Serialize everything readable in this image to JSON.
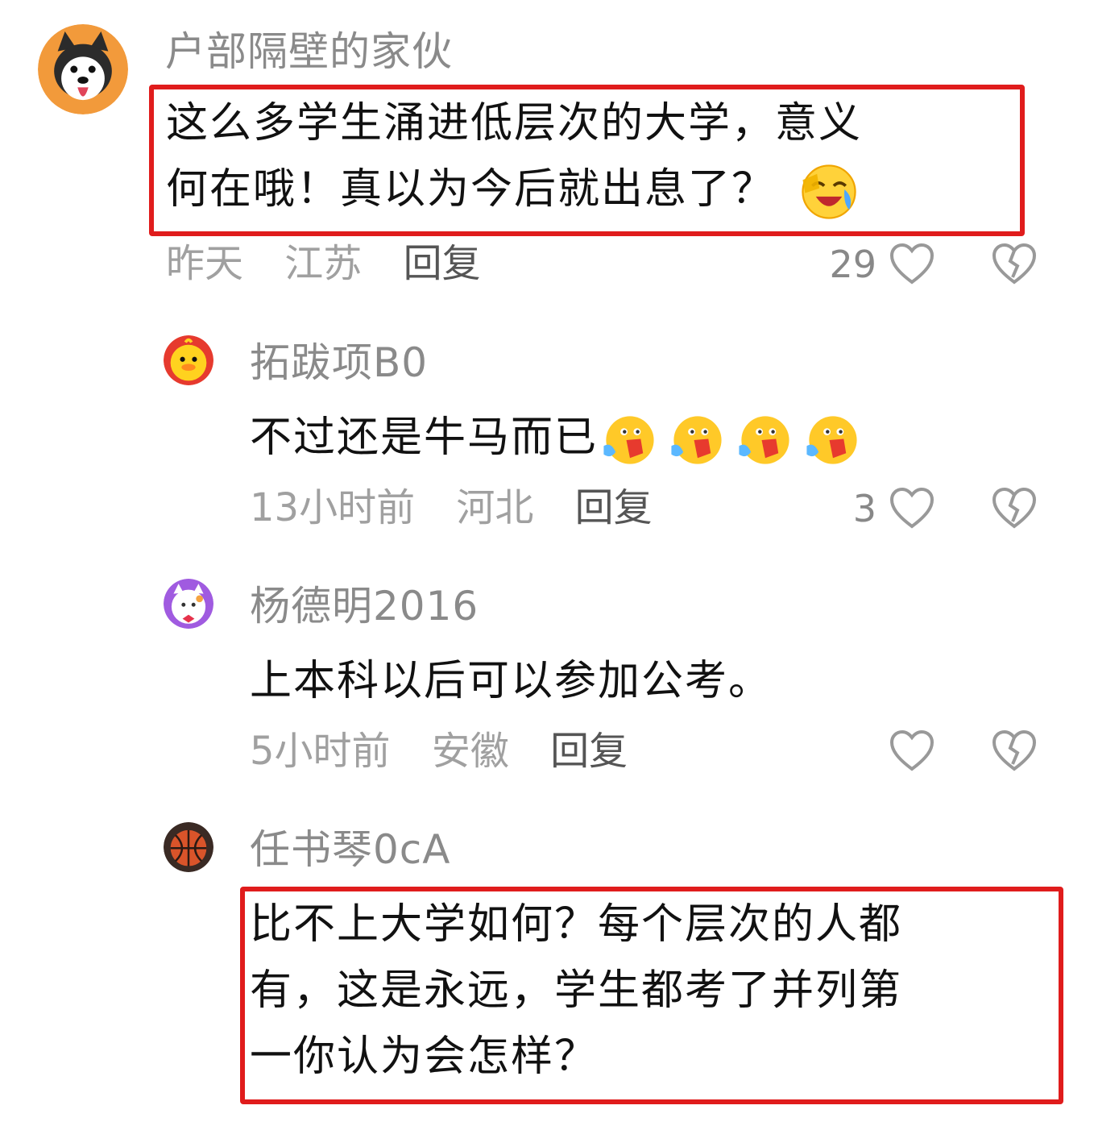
{
  "comments": [
    {
      "username": "户部隔壁的家伙",
      "text_line1": "这么多学生涌进低层次的大学，意义",
      "text_line2": "何在哦！真以为今后就出息了？",
      "emoji": "crying-laughing-emoji",
      "time": "昨天",
      "location": "江苏",
      "reply_label": "回复",
      "likes": "29",
      "highlighted": true
    },
    {
      "username": "拓跋项B0",
      "text": "不过还是牛马而已",
      "emoji": "face-palm-emoji",
      "emoji_count": 4,
      "time": "13小时前",
      "location": "河北",
      "reply_label": "回复",
      "likes": "3"
    },
    {
      "username": "杨德明2016",
      "text": "上本科以后可以参加公考。",
      "time": "5小时前",
      "location": "安徽",
      "reply_label": "回复",
      "likes": ""
    },
    {
      "username": "任书琴0cA",
      "text_line1": "比不上大学如何？每个层次的人都",
      "text_line2": "有，这是永远，学生都考了并列第",
      "text_line3": "一你认为会怎样？",
      "highlighted": true
    }
  ],
  "icons": {
    "like": "heart-outline-icon",
    "dislike": "broken-heart-icon"
  },
  "colors": {
    "highlight_border": "#e01c1c",
    "username": "#8a8a8a",
    "meta": "#a0a0a0"
  }
}
